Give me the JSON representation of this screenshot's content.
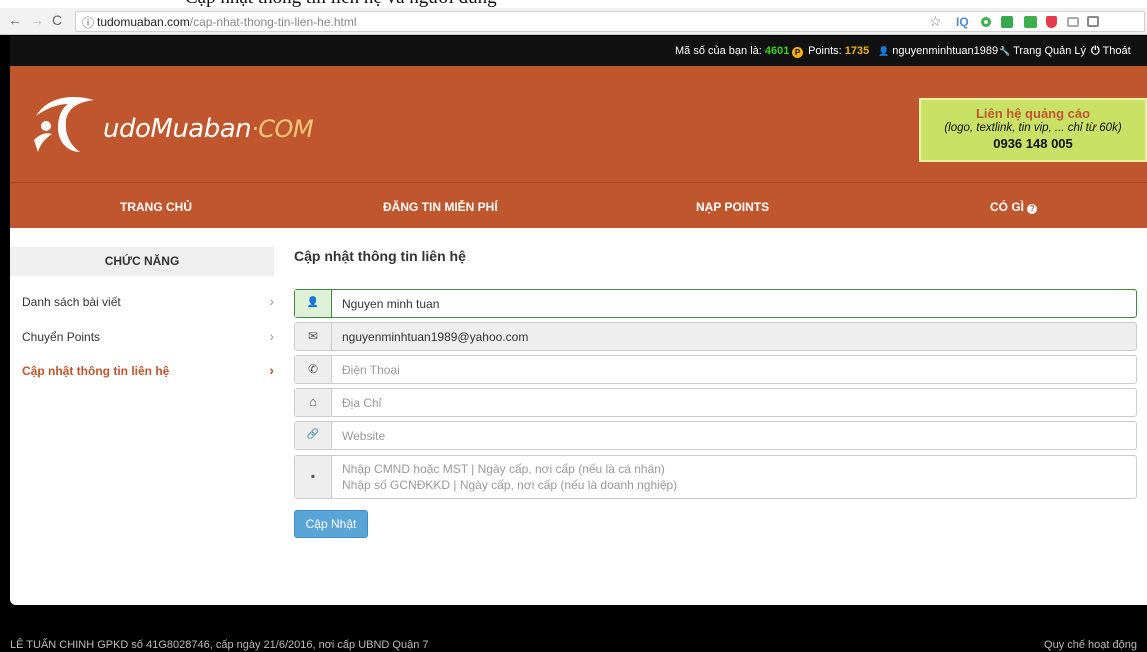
{
  "caption_fragment": "Cập nhật thông tin liên hệ và người dùng",
  "browser": {
    "back": "←",
    "forward": "→",
    "reload": "C",
    "info": "ⓘ",
    "url_domain": "tudomuaban.com",
    "url_path": "/cap-nhat-thong-tin-lien-he.html",
    "star": "☆"
  },
  "topbar": {
    "code_label": "Mã số của bạn là:",
    "code_value": "4601",
    "points_icon": "P",
    "points_label": "Points:",
    "points_value": "1735",
    "user_icon": "👤",
    "username": "nguyenminhtuan1989",
    "admin_icon": "🔧",
    "admin_label": "Trang Quản Lý",
    "logout_icon": "⏻",
    "logout_label": "Thoát"
  },
  "logo": {
    "main": "udoMuaban",
    "dot": "·",
    "com": "COM"
  },
  "ad": {
    "line1": "Liên hệ quảng cáo",
    "line2": "(logo, textlink, tin vip, ... chỉ từ 60k)",
    "line3": "0936 148 005"
  },
  "menu": {
    "home": "TRANG CHỦ",
    "post": "ĐĂNG TIN MIỄN PHÍ",
    "points": "NẠP POINTS",
    "whats": "CÓ GÌ",
    "help_icon": "?"
  },
  "sidebar": {
    "title": "CHỨC NĂNG",
    "chevron": "›",
    "items": [
      {
        "label": "Danh sách bài viết"
      },
      {
        "label": "Chuyển Points"
      },
      {
        "label": "Cập nhật thông tin liên hệ"
      }
    ]
  },
  "form": {
    "title": "Cập nhật thông tin liên hệ",
    "name_value": "Nguyen minh tuan",
    "email_value": "nguyenminhtuan1989@yahoo.com",
    "phone_placeholder": "Điện Thoại",
    "address_placeholder": "Địa Chỉ",
    "website_placeholder": "Website",
    "id_placeholder_1": "Nhập CMND hoặc MST | Ngày cấp, nơi cấp (nếu là cá nhân)",
    "id_placeholder_2": "Nhập số GCNĐKKD | Ngày cấp, nơi cấp (nếu là doanh nghiệp)",
    "submit_label": "Cập Nhật",
    "icons": {
      "user": "👤",
      "email": "✉",
      "phone": "✆",
      "home": "⌂",
      "link": "🔗",
      "note": "▪"
    }
  },
  "footer": {
    "left": "LÊ TUẤN CHINH GPKD số 41G8028746, cấp ngày 21/6/2016, nơi cấp UBND Quận 7",
    "right": "Quy chế hoạt động"
  },
  "colors": {
    "brand": "#c0562d",
    "ad_bg": "#c9e266",
    "button": "#5aa5d8",
    "code_green": "#3cd11b",
    "points_yellow": "#f1b10e"
  }
}
